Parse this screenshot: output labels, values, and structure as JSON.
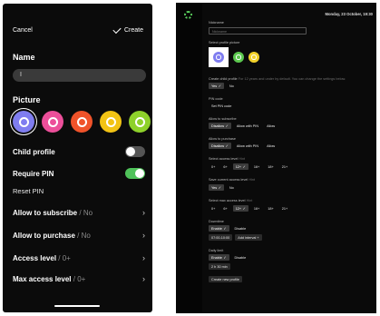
{
  "phone": {
    "cancel_label": "Cancel",
    "create_label": "Create",
    "name_heading": "Name",
    "name_value": "I",
    "picture_heading": "Picture",
    "avatars": [
      {
        "color": "#7f7df0",
        "selected": true
      },
      {
        "color": "#ec4f9a",
        "selected": false
      },
      {
        "color": "#f0532a",
        "selected": false
      },
      {
        "color": "#f2c315",
        "selected": false
      },
      {
        "color": "#8ed12b",
        "selected": false
      }
    ],
    "child_profile_label": "Child profile",
    "child_profile_on": false,
    "require_pin_label": "Require PIN",
    "require_pin_on": true,
    "reset_pin_label": "Reset PIN",
    "settings": [
      {
        "label": "Allow to subscribe",
        "value": "No"
      },
      {
        "label": "Allow to purchase",
        "value": "No"
      },
      {
        "label": "Access level",
        "value": "0+"
      },
      {
        "label": "Max access level",
        "value": "0+"
      }
    ]
  },
  "desktop": {
    "date": "Monday, 23 October, 19:30",
    "nickname_label": "Nickname",
    "nickname_placeholder": "Nickname",
    "picture_label": "Select profile picture",
    "avatars": [
      {
        "color": "#7f7df0",
        "selected": true
      },
      {
        "color": "#5cc84f",
        "selected": false
      },
      {
        "color": "#f2d12a",
        "selected": false
      }
    ],
    "child_label": "Create child profile",
    "child_hint": "For 12 years and under by default. You can change the settings below.",
    "child_options": [
      "Yes",
      "No"
    ],
    "pin_label": "PIN code",
    "pin_button": "Set PIN code",
    "subscribe_label": "Allow to subscribe",
    "subscribe_options": [
      "Disallow",
      "Allow with PIN",
      "Allow"
    ],
    "purchase_label": "Allow to purchase",
    "purchase_options": [
      "Disallow",
      "Allow with PIN",
      "Allow"
    ],
    "access_label": "Select access level",
    "access_hint": "Hint",
    "access_options": [
      "0+",
      "6+",
      "12+",
      "16+",
      "18+",
      "21+"
    ],
    "save_level_label": "Save current access level",
    "save_level_hint": "Hint",
    "save_level_options": [
      "Yes",
      "No"
    ],
    "max_access_label": "Select max access level",
    "max_access_hint": "Hint",
    "max_access_options": [
      "0+",
      "6+",
      "12+",
      "16+",
      "18+",
      "21+"
    ],
    "downtime_label": "Downtime",
    "downtime_options": [
      "Enable",
      "Disable"
    ],
    "downtime_interval": "07:00-10:00",
    "add_interval_label": "Add interval +",
    "daily_label": "Daily limit",
    "daily_options": [
      "Enable",
      "Disable"
    ],
    "daily_value": "2 h 30 min",
    "create_button": "Create new profile"
  }
}
